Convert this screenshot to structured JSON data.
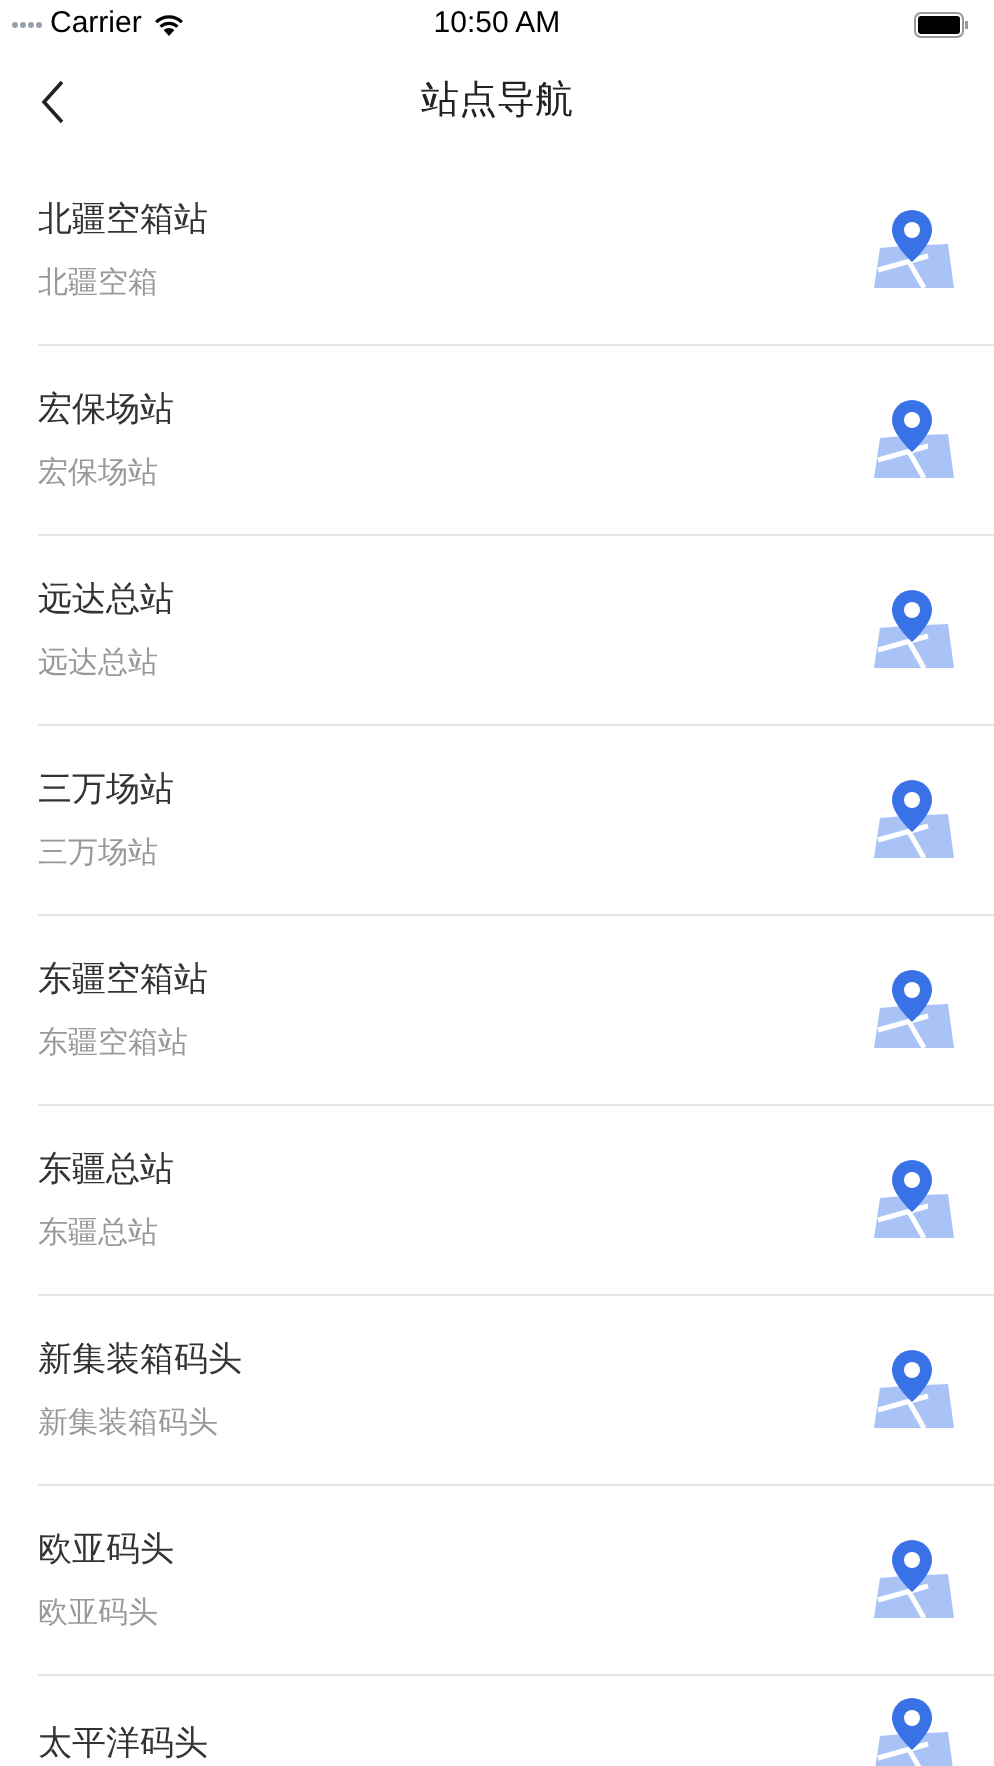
{
  "status_bar": {
    "carrier": "Carrier",
    "time": "10:50 AM"
  },
  "nav": {
    "title": "站点导航"
  },
  "stations": [
    {
      "name": "北疆空箱站",
      "subtitle": "北疆空箱"
    },
    {
      "name": "宏保场站",
      "subtitle": "宏保场站"
    },
    {
      "name": "远达总站",
      "subtitle": "远达总站"
    },
    {
      "name": "三万场站",
      "subtitle": "三万场站"
    },
    {
      "name": "东疆空箱站",
      "subtitle": "东疆空箱站"
    },
    {
      "name": "东疆总站",
      "subtitle": "东疆总站"
    },
    {
      "name": "新集装箱码头",
      "subtitle": "新集装箱码头"
    },
    {
      "name": "欧亚码头",
      "subtitle": "欧亚码头"
    },
    {
      "name": "太平洋码头"
    }
  ]
}
